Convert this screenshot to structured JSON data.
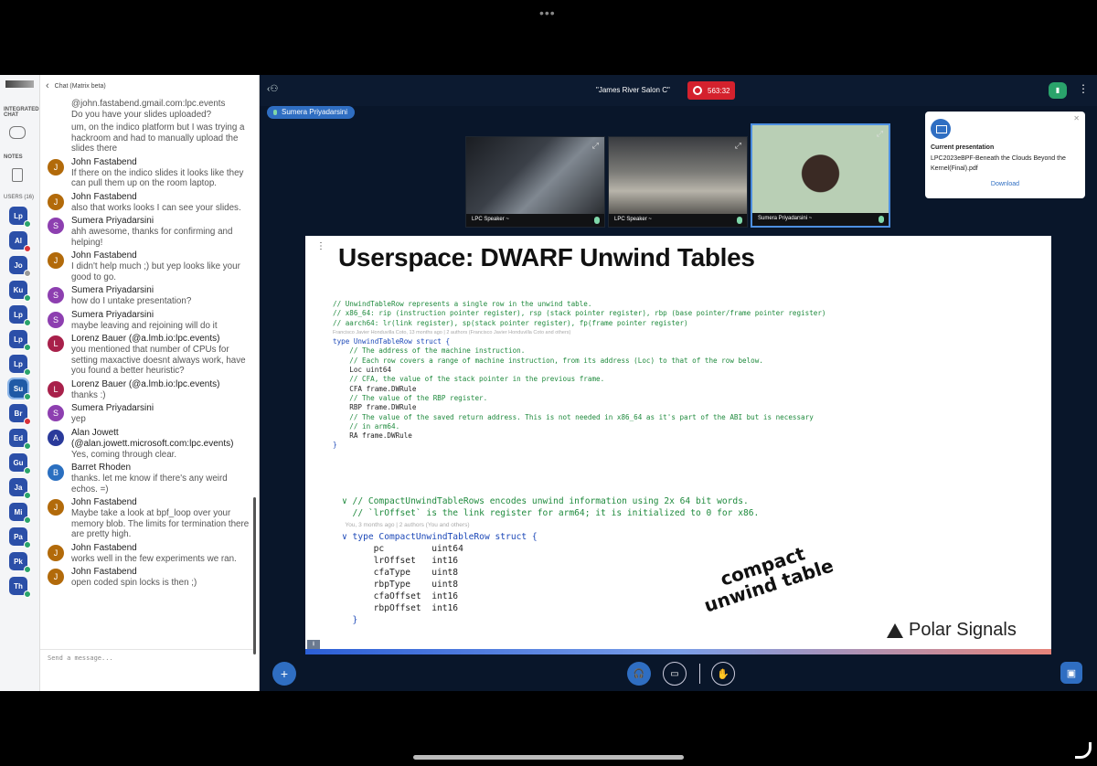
{
  "sidebar": {
    "integrated_chat_label": "INTEGRATED CHAT",
    "notes_label": "NOTES",
    "users_label": "USERS (16)",
    "users": [
      {
        "initials": "Lp",
        "status": "green"
      },
      {
        "initials": "Al",
        "status": "red"
      },
      {
        "initials": "Jo",
        "status": "gray"
      },
      {
        "initials": "Ku",
        "status": "green"
      },
      {
        "initials": "Lp",
        "status": "green"
      },
      {
        "initials": "Lp",
        "status": "green"
      },
      {
        "initials": "Lp",
        "status": "green"
      },
      {
        "initials": "Su",
        "status": "green"
      },
      {
        "initials": "Br",
        "status": "red"
      },
      {
        "initials": "Ed",
        "status": "green"
      },
      {
        "initials": "Gu",
        "status": "green"
      },
      {
        "initials": "Ja",
        "status": "green"
      },
      {
        "initials": "Mi",
        "status": "green"
      },
      {
        "initials": "Pa",
        "status": "green"
      },
      {
        "initials": "Pk",
        "status": "green"
      },
      {
        "initials": "Th",
        "status": "green"
      }
    ]
  },
  "chat": {
    "header": "Chat (Matrix beta)",
    "placeholder": "Send a message...",
    "messages": [
      {
        "initial": "",
        "color": "",
        "name": "",
        "text": "@john.fastabend.gmail.com:lpc.events\nDo you have your slides uploaded?"
      },
      {
        "initial": "",
        "color": "",
        "name": "",
        "text": "um, on the indico platform but I was trying a hackroom and had to manually upload the slides there"
      },
      {
        "initial": "J",
        "color": "#b26a0a",
        "name": "John Fastabend",
        "text": "If there on the indico slides it looks like they can pull them up on the room laptop."
      },
      {
        "initial": "J",
        "color": "#b26a0a",
        "name": "John Fastabend",
        "text": "also that works looks I can see your slides."
      },
      {
        "initial": "S",
        "color": "#8d3fb0",
        "name": "Sumera Priyadarsini",
        "text": "ahh awesome, thanks for confirming and helping!"
      },
      {
        "initial": "J",
        "color": "#b26a0a",
        "name": "John Fastabend",
        "text": "I didn't help much ;) but yep looks like your good to go."
      },
      {
        "initial": "S",
        "color": "#8d3fb0",
        "name": "Sumera Priyadarsini",
        "text": "how do I untake presentation?"
      },
      {
        "initial": "S",
        "color": "#8d3fb0",
        "name": "Sumera Priyadarsini",
        "text": "maybe leaving and rejoining will do it"
      },
      {
        "initial": "L",
        "color": "#a8204a",
        "name": "Lorenz Bauer (@a.lmb.io:lpc.events)",
        "text": "you mentioned that number of CPUs for setting maxactive doesnt always work, have you found a better heuristic?"
      },
      {
        "initial": "L",
        "color": "#a8204a",
        "name": "Lorenz Bauer (@a.lmb.io:lpc.events)",
        "text": "thanks :)"
      },
      {
        "initial": "S",
        "color": "#8d3fb0",
        "name": "Sumera Priyadarsini",
        "text": "yep"
      },
      {
        "initial": "A",
        "color": "#2a3a9a",
        "name": "Alan Jowett (@alan.jowett.microsoft.com:lpc.events)",
        "text": "Yes, coming through clear."
      },
      {
        "initial": "B",
        "color": "#2a6fc0",
        "name": "Barret Rhoden",
        "text": "thanks. let me know if there's any weird echos. =)"
      },
      {
        "initial": "J",
        "color": "#b26a0a",
        "name": "John Fastabend",
        "text": "Maybe take a look at bpf_loop over your memory blob. The limits for termination there are pretty high."
      },
      {
        "initial": "J",
        "color": "#b26a0a",
        "name": "John Fastabend",
        "text": "works well in the few experiments we ran."
      },
      {
        "initial": "J",
        "color": "#b26a0a",
        "name": "John Fastabend",
        "text": "open coded spin locks is then ;)"
      }
    ]
  },
  "conference": {
    "room": "\"James River Salon C\"",
    "timer": "563:32",
    "presenter": "Sumera Priyadarsini",
    "tiles": [
      {
        "caption": "LPC Speaker ~"
      },
      {
        "caption": "LPC Speaker ~"
      },
      {
        "caption": "Sumera Priyadarsini ~"
      }
    ],
    "current_presentation": {
      "title": "Current presentation",
      "file": "LPC2023eBPF-Beneath the Clouds Beyond the Kernel(Final).pdf",
      "download": "Download"
    }
  },
  "slide": {
    "title": "Userspace: DWARF Unwind Tables",
    "code1": [
      {
        "t": "// UnwindTableRow represents a single row in the unwind table.",
        "c": "green"
      },
      {
        "t": "// x86_64: rip (instruction pointer register), rsp (stack pointer register), rbp (base pointer/frame pointer register)",
        "c": "green"
      },
      {
        "t": "// aarch64: lr(link register), sp(stack pointer register), fp(frame pointer register)",
        "c": "green"
      },
      {
        "t": "Francisco Javier Honduvilla Coto, 13 months ago | 2 authors (Francisco Javier Honduvilla Coto and others)",
        "c": "gray"
      },
      {
        "t": "type UnwindTableRow struct {",
        "c": "blue"
      },
      {
        "t": "    // The address of the machine instruction.",
        "c": "green"
      },
      {
        "t": "    // Each row covers a range of machine instruction, from its address (Loc) to that of the row below.",
        "c": "green"
      },
      {
        "t": "    Loc uint64",
        "c": "plain"
      },
      {
        "t": "    // CFA, the value of the stack pointer in the previous frame.",
        "c": "green"
      },
      {
        "t": "    CFA frame.DWRule",
        "c": "plain"
      },
      {
        "t": "    // The value of the RBP register.",
        "c": "green"
      },
      {
        "t": "    RBP frame.DWRule",
        "c": "plain"
      },
      {
        "t": "    // The value of the saved return address. This is not needed in x86_64 as it's part of the ABI but is necessary",
        "c": "green"
      },
      {
        "t": "    // in arm64.",
        "c": "green"
      },
      {
        "t": "    RA frame.DWRule",
        "c": "plain"
      },
      {
        "t": "}",
        "c": "blue"
      }
    ],
    "code2": [
      {
        "t": "∨ // CompactUnwindTableRows encodes unwind information using 2x 64 bit words.",
        "c": "green"
      },
      {
        "t": "  // `lrOffset` is the link register for arm64; it is initialized to 0 for x86.",
        "c": "green"
      },
      {
        "t": "  You, 3 months ago | 2 authors (You and others)",
        "c": "gray"
      },
      {
        "t": "∨ type CompactUnwindTableRow struct {",
        "c": "blue"
      },
      {
        "t": "      pc         uint64",
        "c": "plain"
      },
      {
        "t": "      lrOffset   int16",
        "c": "plain"
      },
      {
        "t": "      cfaType    uint8",
        "c": "plain"
      },
      {
        "t": "      rbpType    uint8",
        "c": "plain"
      },
      {
        "t": "      cfaOffset  int16",
        "c": "plain"
      },
      {
        "t": "      rbpOffset  int16",
        "c": "plain"
      },
      {
        "t": "  }",
        "c": "blue"
      }
    ],
    "annotation_line1": "compact",
    "annotation_line2": "unwind table",
    "brand": "Polar Signals"
  }
}
